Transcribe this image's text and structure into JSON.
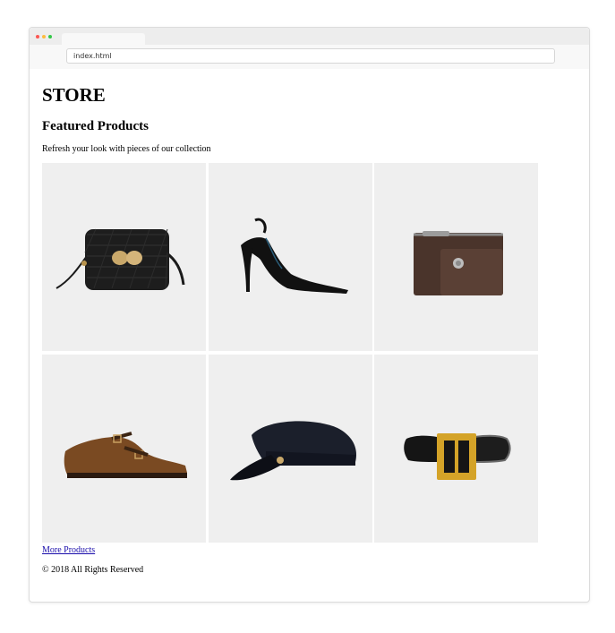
{
  "browser": {
    "url": "index.html"
  },
  "page": {
    "store_title": "STORE",
    "section_title": "Featured Products",
    "tagline": "Refresh your look with pieces of our collection",
    "more_link": "More Products",
    "footer": "© 2018 All Rights Reserved"
  },
  "products": [
    {
      "icon": "crossbody-bag-icon"
    },
    {
      "icon": "slingback-heel-icon"
    },
    {
      "icon": "card-wallet-icon"
    },
    {
      "icon": "monk-shoe-icon"
    },
    {
      "icon": "captain-cap-icon"
    },
    {
      "icon": "belt-icon"
    }
  ],
  "colors": {
    "card_background": "#efefef",
    "link": "#1a0dab",
    "window_chrome": "#ededed"
  }
}
